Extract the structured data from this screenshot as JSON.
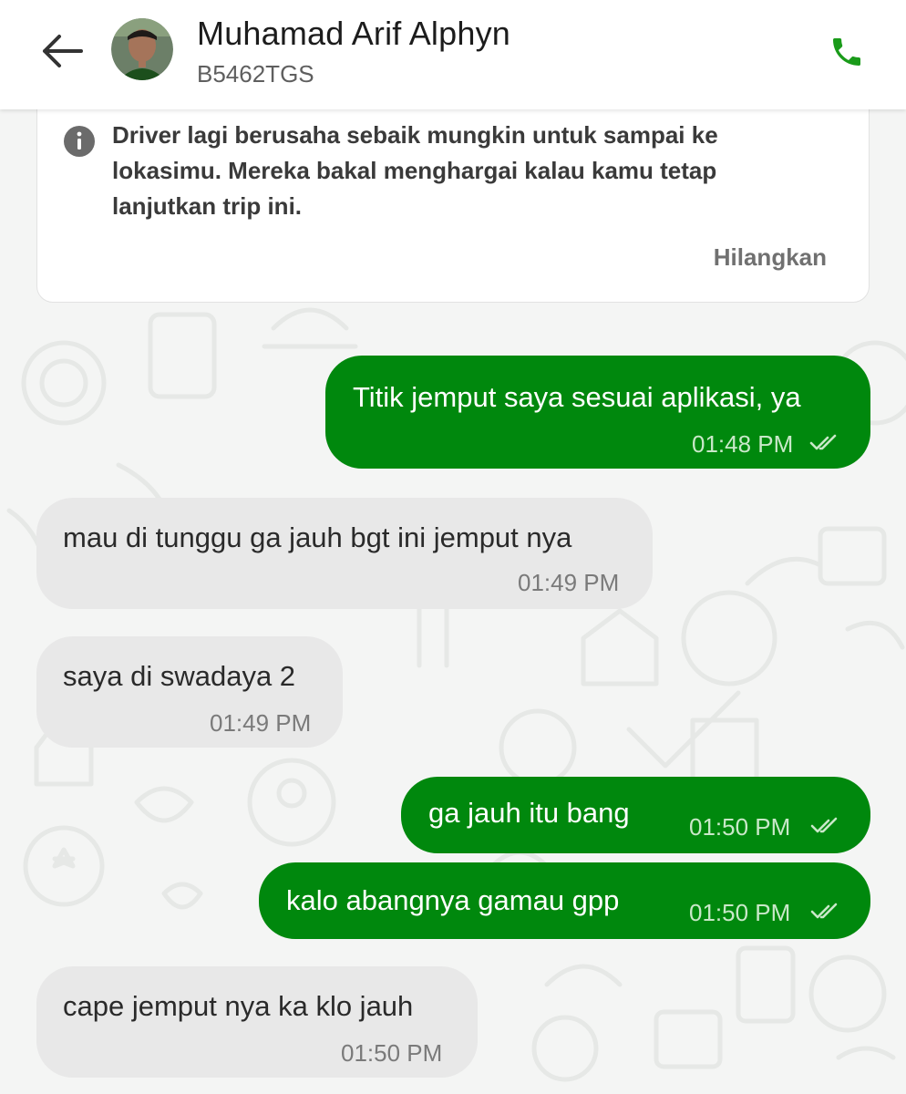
{
  "header": {
    "driver_name": "Muhamad Arif Alphyn",
    "plate_number": "B5462TGS",
    "icons": {
      "back": "arrow-left-icon",
      "call": "phone-icon"
    },
    "call_color": "#1a9b1a"
  },
  "info_banner": {
    "text": "Driver lagi berusaha sebaik mungkin untuk sampai ke lokasimu. Mereka bakal menghargai kalau kamu tetap lanjutkan trip ini.",
    "dismiss_label": "Hilangkan",
    "icon": "info-icon"
  },
  "colors": {
    "outgoing_bubble": "#00880d",
    "incoming_bubble": "#e8e8e8",
    "background": "#f4f5f4"
  },
  "messages": [
    {
      "direction": "out",
      "text": "Titik jemput saya sesuai aplikasi, ya",
      "time": "01:48 PM",
      "status": "read"
    },
    {
      "direction": "in",
      "text": "mau di tunggu ga jauh bgt ini jemput nya",
      "time": "01:49 PM"
    },
    {
      "direction": "in",
      "text": "saya di swadaya 2",
      "time": "01:49 PM"
    },
    {
      "direction": "out",
      "text": "ga jauh itu bang",
      "time": "01:50 PM",
      "status": "read"
    },
    {
      "direction": "out",
      "text": "kalo abangnya gamau gpp",
      "time": "01:50 PM",
      "status": "read"
    },
    {
      "direction": "in",
      "text": "cape jemput nya ka klo jauh",
      "time": "01:50 PM"
    }
  ]
}
